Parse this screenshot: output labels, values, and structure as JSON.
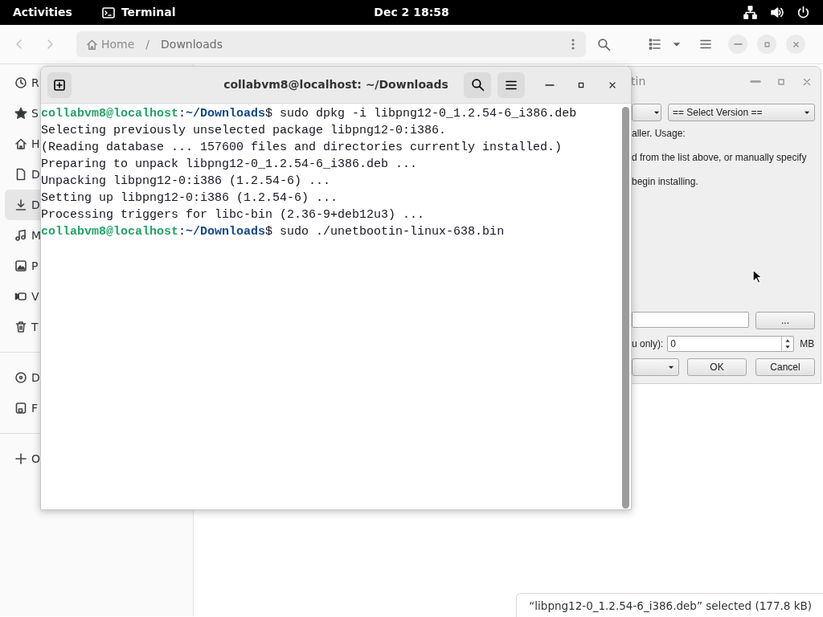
{
  "top_bar": {
    "activities": "Activities",
    "app": {
      "label": "Terminal"
    },
    "clock": "Dec 2  18:58"
  },
  "files_window": {
    "path": [
      {
        "label": "Home",
        "kind": "home"
      },
      {
        "label": "Downloads",
        "kind": "folder",
        "separator": "/"
      }
    ],
    "sidebar": {
      "groups": [
        [
          {
            "label": "R",
            "kind": "recent",
            "selected": false
          },
          {
            "label": "S",
            "kind": "starred",
            "selected": false
          },
          {
            "label": "H",
            "kind": "home",
            "selected": false
          },
          {
            "label": "D",
            "kind": "documents",
            "selected": false
          },
          {
            "label": "D",
            "kind": "downloads",
            "selected": true
          },
          {
            "label": "M",
            "kind": "music",
            "selected": false
          },
          {
            "label": "P",
            "kind": "pictures",
            "selected": false
          },
          {
            "label": "V",
            "kind": "videos",
            "selected": false
          },
          {
            "label": "T",
            "kind": "trash",
            "selected": false
          }
        ],
        [
          {
            "label": "D",
            "kind": "disc",
            "selected": false
          },
          {
            "label": "F",
            "kind": "drive",
            "selected": false
          }
        ],
        [
          {
            "label": "O",
            "kind": "add",
            "selected": false
          }
        ]
      ]
    },
    "status": "“libpng12-0_1.2.54-6_i386.deb” selected  (177.8 kB)"
  },
  "unetbootin_window": {
    "title": "tin",
    "version_select": "== Select Version ==",
    "text_lines": [
      "aller. Usage:",
      "d from the list above, or manually specify",
      "begin installing."
    ],
    "browse_button": "...",
    "size_label": "u only):",
    "size_value": "0",
    "size_unit": "MB",
    "ok_button": "OK",
    "cancel_button": "Cancel"
  },
  "terminal_window": {
    "title": "collabvm8@localhost: ~/Downloads",
    "lines": [
      {
        "kind": "prompt",
        "user": "collabvm8@localhost",
        "sep": ":",
        "path": "~/Downloads",
        "command": "$ sudo dpkg -i libpng12-0_1.2.54-6_i386.deb"
      },
      {
        "kind": "output",
        "text": "Selecting previously unselected package libpng12-0:i386."
      },
      {
        "kind": "output",
        "text": "(Reading database ... 157600 files and directories currently installed.)"
      },
      {
        "kind": "output",
        "text": "Preparing to unpack libpng12-0_1.2.54-6_i386.deb ..."
      },
      {
        "kind": "output",
        "text": "Unpacking libpng12-0:i386 (1.2.54-6) ..."
      },
      {
        "kind": "output",
        "text": "Setting up libpng12-0:i386 (1.2.54-6) ..."
      },
      {
        "kind": "output",
        "text": "Processing triggers for libc-bin (2.36-9+deb12u3) ..."
      },
      {
        "kind": "prompt",
        "user": "collabvm8@localhost",
        "sep": ":",
        "path": "~/Downloads",
        "command": "$ sudo ./unetbootin-linux-638.bin"
      }
    ]
  }
}
